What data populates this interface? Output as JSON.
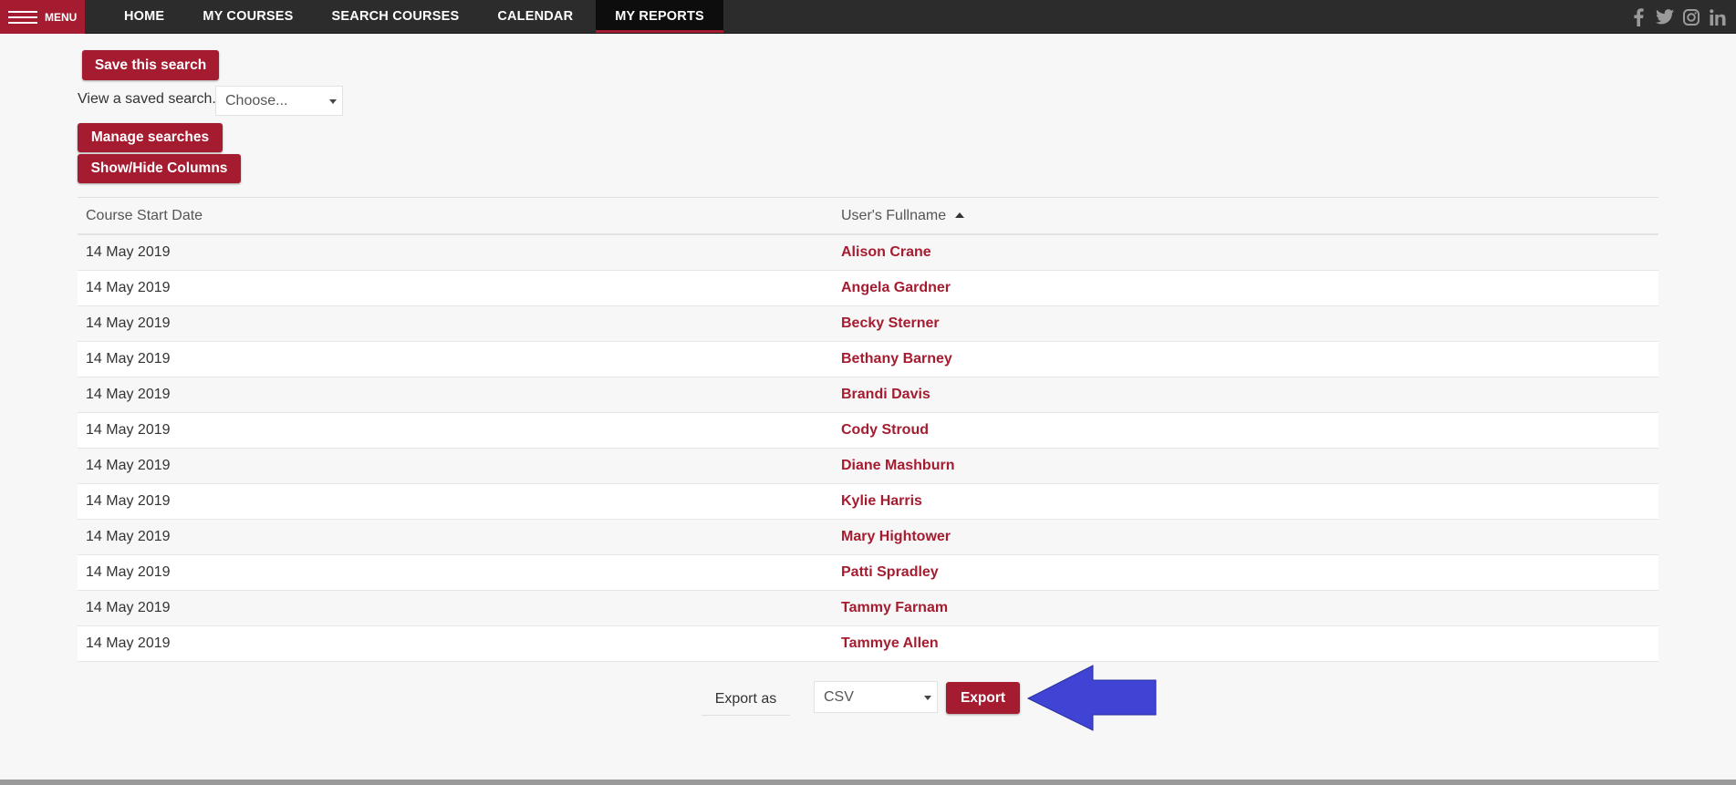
{
  "nav": {
    "menu_label": "MENU",
    "items": [
      {
        "label": "HOME",
        "active": false
      },
      {
        "label": "MY COURSES",
        "active": false
      },
      {
        "label": "SEARCH COURSES",
        "active": false
      },
      {
        "label": "CALENDAR",
        "active": false
      },
      {
        "label": "MY REPORTS",
        "active": true
      }
    ],
    "social_icons": [
      "facebook-icon",
      "twitter-icon",
      "instagram-icon",
      "linkedin-icon"
    ]
  },
  "controls": {
    "save_search_label": "Save this search",
    "saved_search_label": "View a saved search...",
    "saved_search_value": "Choose...",
    "manage_searches_label": "Manage searches",
    "show_hide_columns_label": "Show/Hide Columns"
  },
  "table": {
    "columns": [
      "Course Start Date",
      "User's Fullname"
    ],
    "sorted_column": "User's Fullname",
    "sort_direction": "ascending",
    "rows": [
      {
        "date": "14 May 2019",
        "name": "Alison Crane"
      },
      {
        "date": "14 May 2019",
        "name": "Angela Gardner"
      },
      {
        "date": "14 May 2019",
        "name": "Becky Sterner"
      },
      {
        "date": "14 May 2019",
        "name": "Bethany Barney"
      },
      {
        "date": "14 May 2019",
        "name": "Brandi Davis"
      },
      {
        "date": "14 May 2019",
        "name": "Cody Stroud"
      },
      {
        "date": "14 May 2019",
        "name": "Diane Mashburn"
      },
      {
        "date": "14 May 2019",
        "name": "Kylie Harris"
      },
      {
        "date": "14 May 2019",
        "name": "Mary Hightower"
      },
      {
        "date": "14 May 2019",
        "name": "Patti Spradley"
      },
      {
        "date": "14 May 2019",
        "name": "Tammy Farnam"
      },
      {
        "date": "14 May 2019",
        "name": "Tammye Allen"
      }
    ]
  },
  "export": {
    "label": "Export as",
    "format_value": "CSV",
    "button_label": "Export"
  },
  "colors": {
    "brand": "#a51c30",
    "nav_bg": "#2c2c2c",
    "annotation_arrow": "#3f44d4"
  }
}
